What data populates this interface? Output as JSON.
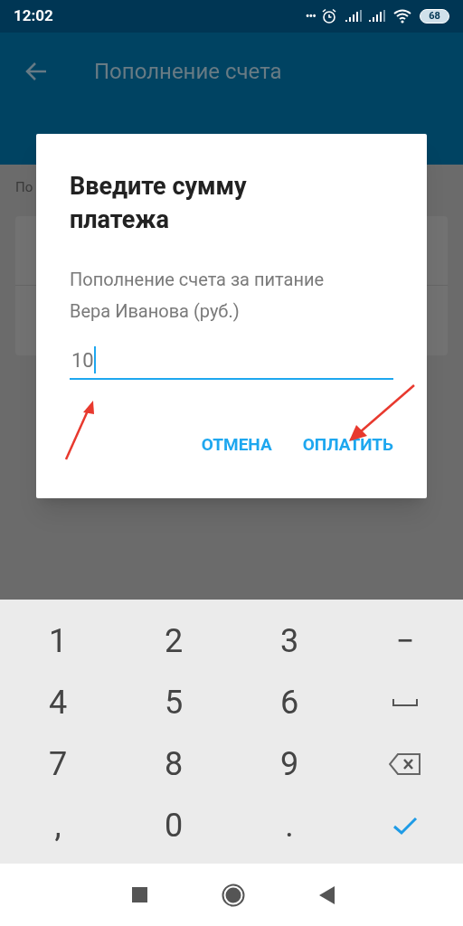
{
  "status_bar": {
    "time": "12:02",
    "dots": "•••",
    "battery": "68"
  },
  "app_bar": {
    "title": "Пополнение счета"
  },
  "background": {
    "caption": "По"
  },
  "dialog": {
    "title": "Введите сумму платежа",
    "message": "Пополнение счета за питание Вера Иванова (руб.)",
    "input": {
      "value": "10"
    },
    "buttons": [
      "ОТМЕНА",
      "ОПЛАТИТЬ"
    ]
  },
  "keyboard": {
    "keys": [
      {
        "kind": "char",
        "label": "1"
      },
      {
        "kind": "char",
        "label": "2"
      },
      {
        "kind": "char",
        "label": "3"
      },
      {
        "kind": "char",
        "label": "−"
      },
      {
        "kind": "char",
        "label": "4"
      },
      {
        "kind": "char",
        "label": "5"
      },
      {
        "kind": "char",
        "label": "6"
      },
      {
        "kind": "space"
      },
      {
        "kind": "char",
        "label": "7"
      },
      {
        "kind": "char",
        "label": "8"
      },
      {
        "kind": "char",
        "label": "9"
      },
      {
        "kind": "backspace"
      },
      {
        "kind": "char",
        "label": ","
      },
      {
        "kind": "char",
        "label": "0"
      },
      {
        "kind": "char",
        "label": "."
      },
      {
        "kind": "done"
      }
    ]
  }
}
